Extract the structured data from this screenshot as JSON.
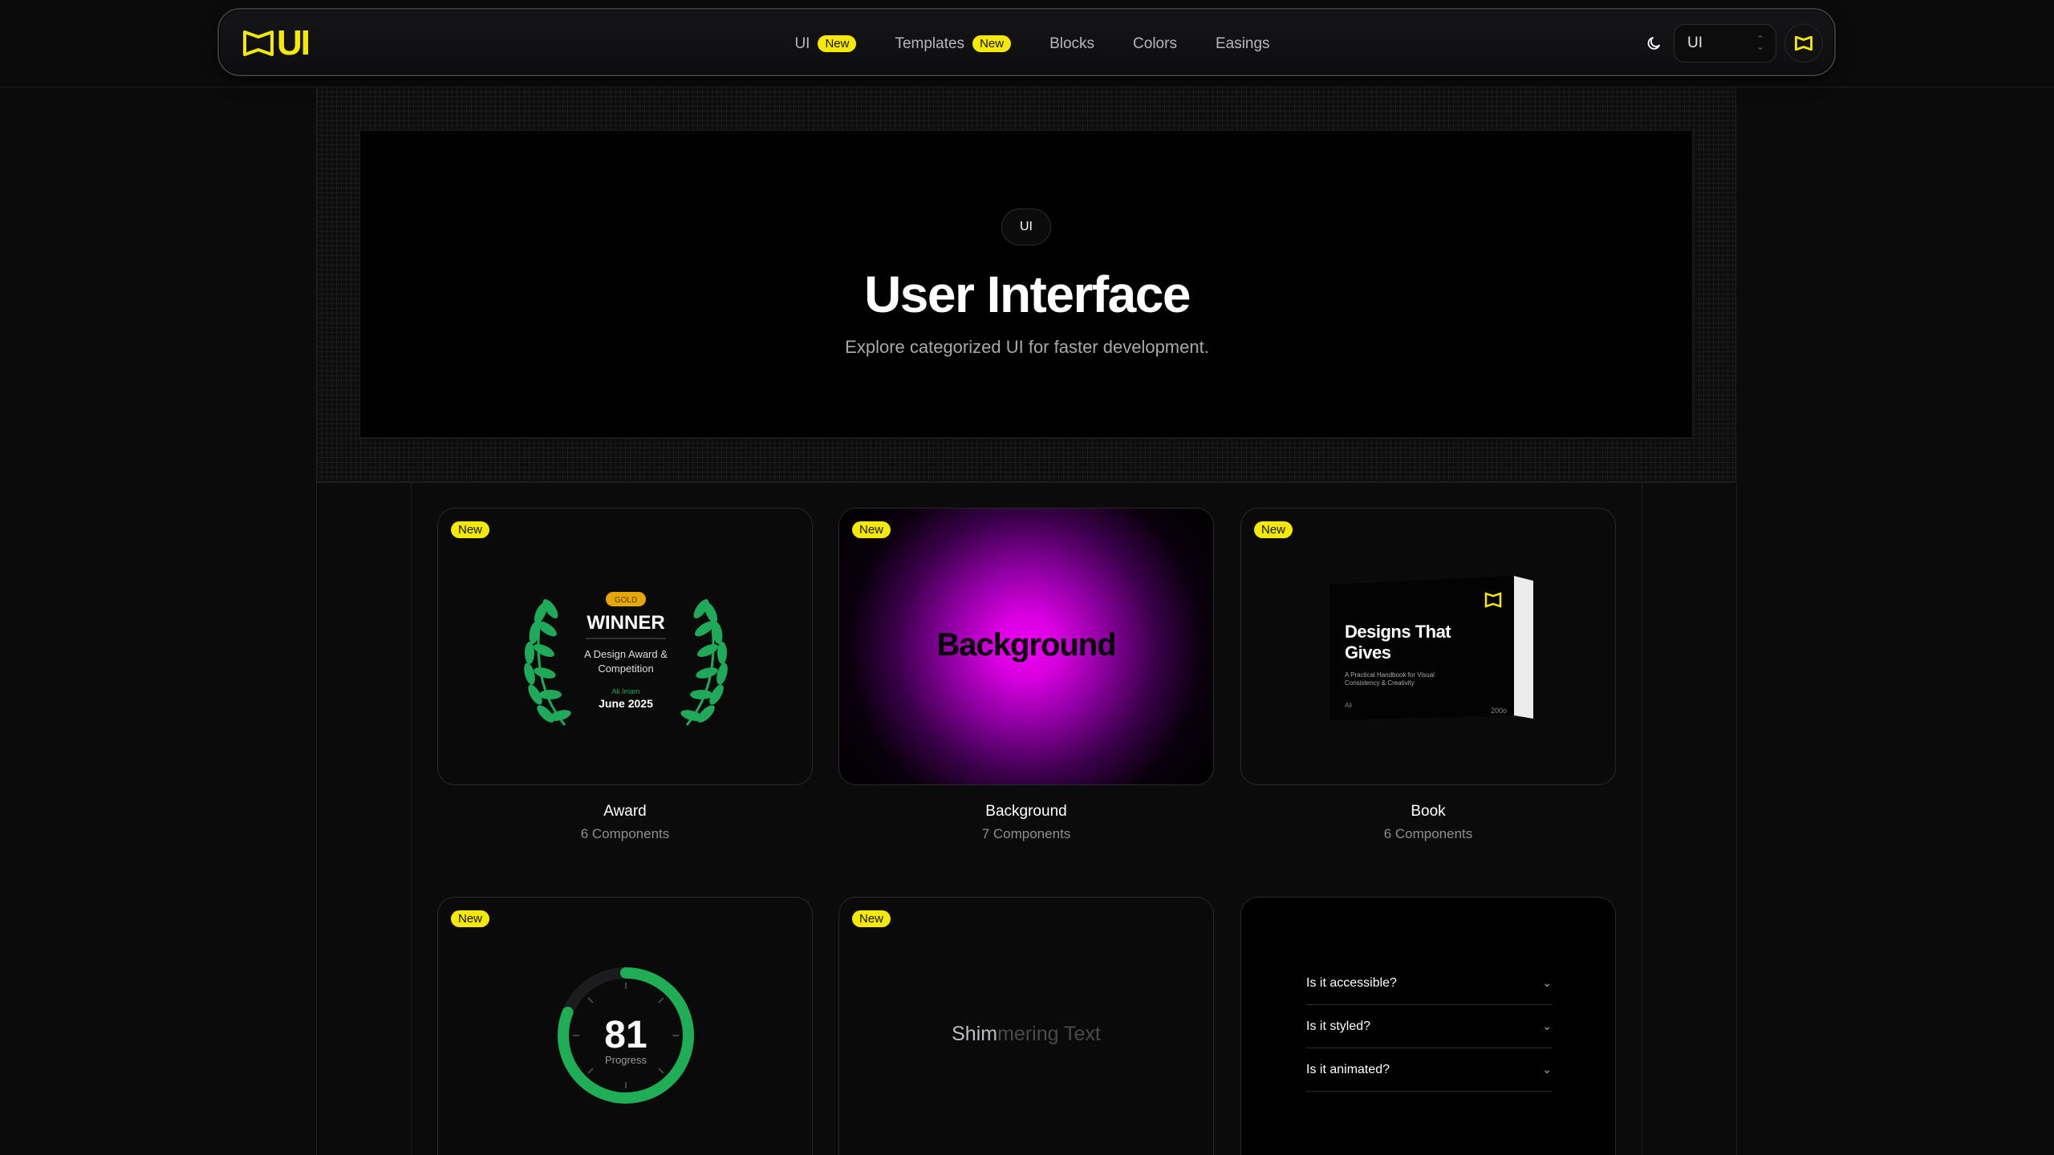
{
  "nav": {
    "logo_text": "UI",
    "links": [
      {
        "label": "UI",
        "badge": "New"
      },
      {
        "label": "Templates",
        "badge": "New"
      },
      {
        "label": "Blocks",
        "badge": ""
      },
      {
        "label": "Colors",
        "badge": ""
      },
      {
        "label": "Easings",
        "badge": ""
      }
    ],
    "select_value": "UI",
    "theme_icon": "moon-icon",
    "brand_icon": "logo-mark-icon"
  },
  "hero": {
    "pill": "UI",
    "title": "User Interface",
    "subtitle": "Explore categorized UI for faster development."
  },
  "cards": [
    {
      "badge": "New",
      "title": "Award",
      "subtitle": "6 Components",
      "preview": {
        "tier": "GOLD",
        "headline": "WINNER",
        "line1": "A Design Award &",
        "line2": "Competition",
        "author": "Ali Imam",
        "date": "June 2025"
      }
    },
    {
      "badge": "New",
      "title": "Background",
      "subtitle": "7 Components",
      "preview": {
        "text": "Background"
      }
    },
    {
      "badge": "New",
      "title": "Book",
      "subtitle": "6 Components",
      "preview": {
        "title1": "Designs That",
        "title2": "Gives",
        "desc1": "A Practical Handbook for Visual",
        "desc2": "Consistency & Creativity",
        "author": "Ali",
        "year": "200o"
      }
    },
    {
      "badge": "New",
      "preview": {
        "value": "81",
        "label": "Progress",
        "progress": 0.81
      }
    },
    {
      "badge": "New",
      "preview": {
        "lit": "Shim",
        "dim": "mering Text"
      }
    },
    {
      "badge": "",
      "preview": {
        "questions": [
          "Is it accessible?",
          "Is it styled?",
          "Is it animated?"
        ]
      }
    }
  ],
  "colors": {
    "accent": "#f5e900",
    "background": "#0b0b0c",
    "laurel": "#1faa5a",
    "glow": "#f000f5",
    "ring": "#22c55e"
  }
}
